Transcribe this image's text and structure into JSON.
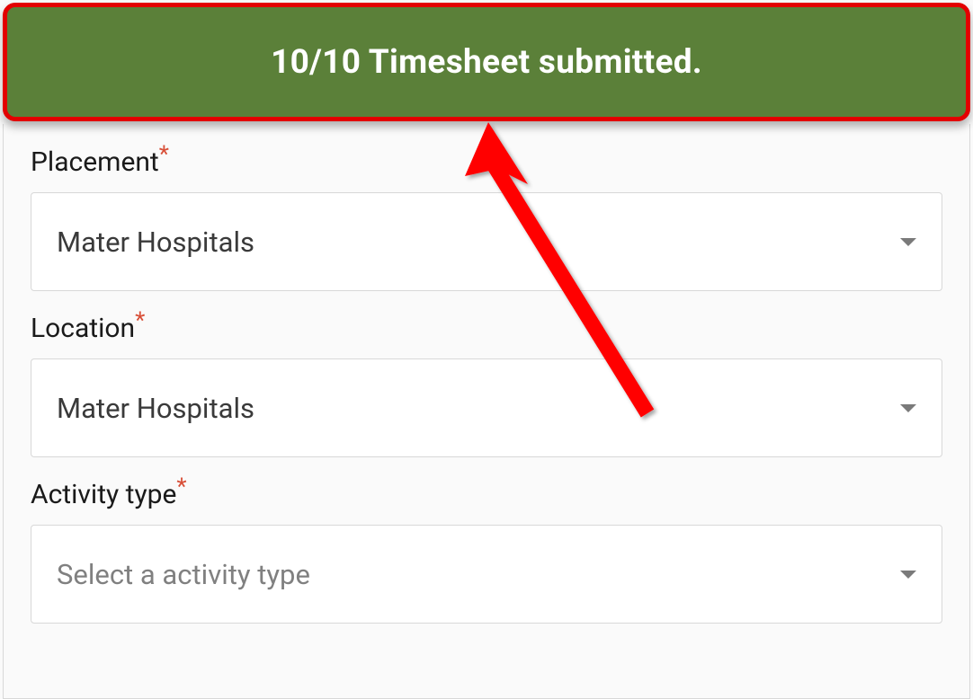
{
  "banner": {
    "message": "10/10 Timesheet submitted."
  },
  "form": {
    "placement": {
      "label": "Placement",
      "required": "*",
      "value": "Mater Hospitals"
    },
    "location": {
      "label": "Location",
      "required": "*",
      "value": "Mater Hospitals"
    },
    "activityType": {
      "label": "Activity type",
      "required": "*",
      "placeholder": "Select a activity type"
    }
  }
}
